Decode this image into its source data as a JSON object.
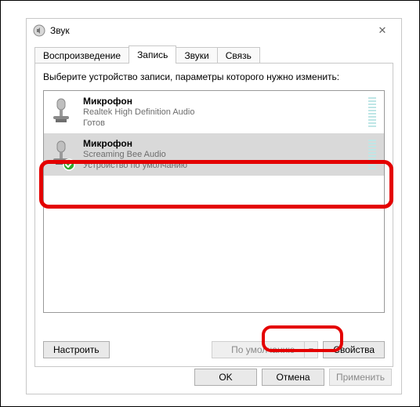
{
  "window": {
    "title": "Звук",
    "close_icon": "✕"
  },
  "tabs": {
    "playback": "Воспроизведение",
    "recording": "Запись",
    "sounds": "Звуки",
    "communications": "Связь"
  },
  "panel": {
    "instruction": "Выберите устройство записи, параметры которого нужно изменить:"
  },
  "devices": [
    {
      "name": "Микрофон",
      "driver": "Realtek High Definition Audio",
      "status": "Готов",
      "default": false,
      "selected": false
    },
    {
      "name": "Микрофон",
      "driver": "Screaming Bee Audio",
      "status": "Устройство по умолчанию",
      "default": true,
      "selected": true
    }
  ],
  "buttons": {
    "configure": "Настроить",
    "set_default": "По умолчанию",
    "properties": "Свойства",
    "ok": "OK",
    "cancel": "Отмена",
    "apply": "Применить"
  }
}
